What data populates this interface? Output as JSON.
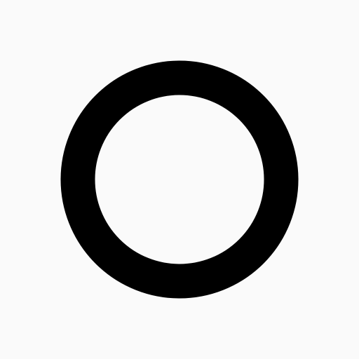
{
  "canvas": {
    "background_color": "#fafafa"
  },
  "icon": {
    "name": "circle-outline-icon",
    "color": "#000000"
  }
}
